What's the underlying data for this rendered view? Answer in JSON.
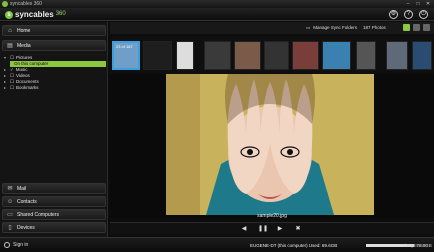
{
  "window": {
    "title": "syncables 360",
    "minimize": "–",
    "maximize": "□",
    "close": "✕"
  },
  "brand": {
    "name": "syncables",
    "version": "360",
    "icons": [
      "gear-icon",
      "help-icon",
      "power-icon"
    ]
  },
  "sidebar": {
    "home": {
      "label": "Home",
      "icon": "home-icon"
    },
    "media": {
      "label": "Media",
      "icon": "media-icon"
    },
    "tree": [
      {
        "label": "Pictures",
        "expanded": true,
        "check": "☐"
      },
      {
        "label": "On this computer",
        "selected": true
      },
      {
        "label": "Music",
        "check": "✓"
      },
      {
        "label": "Videos",
        "check": "☐"
      },
      {
        "label": "Documents",
        "check": "☐"
      },
      {
        "label": "Bookmarks",
        "check": "☐"
      }
    ],
    "bottom": [
      {
        "label": "Mail",
        "icon": "mail-icon"
      },
      {
        "label": "Contacts",
        "icon": "contacts-icon"
      },
      {
        "label": "Shared Computers",
        "icon": "computers-icon"
      },
      {
        "label": "Devices",
        "icon": "devices-icon"
      }
    ]
  },
  "toolbar": {
    "manage": "Manage Sync Folders",
    "count": "187 Photos",
    "views": [
      "grid-view",
      "list-view",
      "slideshow-view"
    ]
  },
  "thumbs": {
    "selected_caption": "23 of 187",
    "colors": [
      "#6f9fc8",
      "#222",
      "#ddd",
      "#444",
      "#7a5b4a",
      "#333",
      "#7a3e3a",
      "#3a80b0",
      "#555",
      "#5f6a78",
      "#2a4c70"
    ]
  },
  "viewer": {
    "filename": "sample20.jpg"
  },
  "controls": [
    "prev-icon",
    "pause-icon",
    "next-icon",
    "shuffle-icon"
  ],
  "status": {
    "text": "EUGENE-DT (this computer)   Used: 69.6GB",
    "right": "/ 90pt 78.0GB",
    "usage_fraction": 0.77
  },
  "signin": {
    "label": "Sign in"
  }
}
